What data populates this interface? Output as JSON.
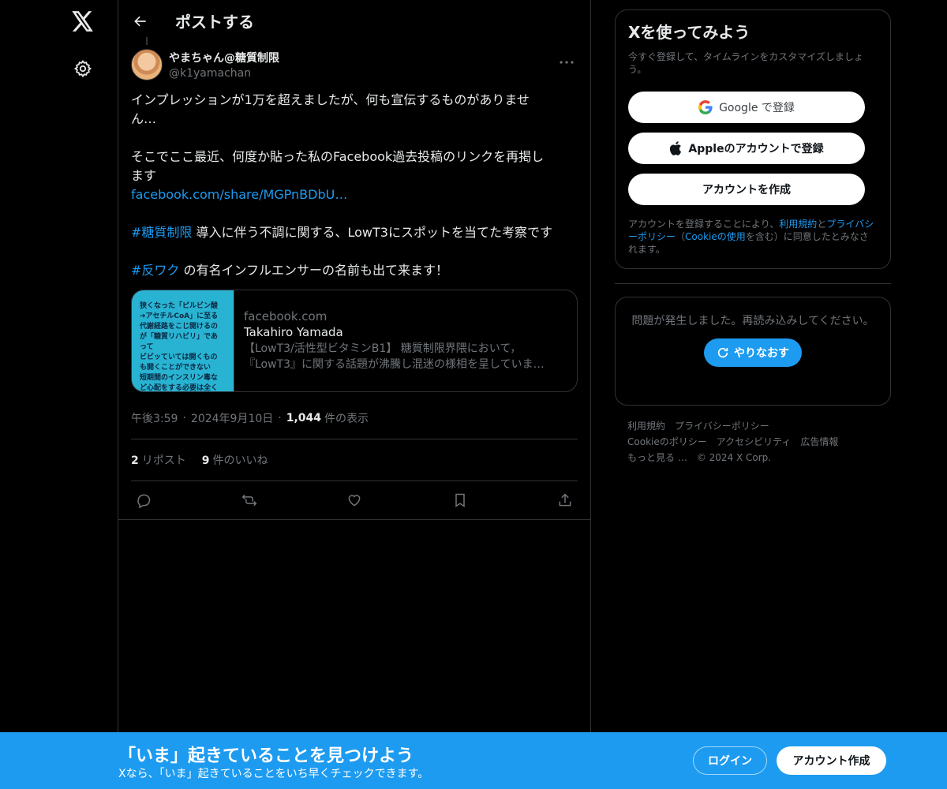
{
  "header": {
    "title": "ポストする"
  },
  "tweet": {
    "display_name": "やまちゃん@糖質制限",
    "handle": "@k1yamachan",
    "line1": "インプレッションが1万を超えましたが、何も宣伝するものがありませ",
    "line2": "ん…",
    "line3": "そこでここ最近、何度か貼った私のFacebook過去投稿のリンクを再掲し",
    "line4": "ます",
    "link": "facebook.com/share/MGPnBDbU…",
    "hashtag1": "#糖質制限",
    "line5": " 導入に伴う不調に関する、LowT3にスポットを当てた考察です",
    "hashtag2": "#反ワク",
    "line6": " の有名インフルエンサーの名前も出て来ます！",
    "card": {
      "thumb_text": "狭くなった「ピルビン酸\n➔アセチルCoA」に至る\n代謝経路をこじ開けるの\nが「糖質リハビリ」であ\nって\nビビッていては開くもの\nも開くことができない\n短期間のインスリン毒な\nど心配をする必要は全く",
      "domain": "facebook.com",
      "title": "Takahiro Yamada",
      "desc1": "【LowT3/活性型ビタミンB1】 糖質制限界隈において，",
      "desc2": "『LowT3』に関する話題が沸騰し混迷の様相を呈していま…"
    },
    "time": "午後3:59",
    "dot": "·",
    "date": "2024年9月10日",
    "views_count": "1,044",
    "views_label": "件の表示",
    "reposts_count": "2",
    "reposts_label": "リポスト",
    "likes_count": "9",
    "likes_label": "件のいいね"
  },
  "signup_panel": {
    "title": "Xを使ってみよう",
    "subtitle": "今すぐ登録して、タイムラインをカスタマイズしましょう。",
    "google_label": "Google で登録",
    "apple_label": "Appleのアカウントで登録",
    "create_label": "アカウントを作成",
    "legal_pre": "アカウントを登録することにより、",
    "legal_terms": "利用規約",
    "legal_and": "と",
    "legal_privacy": "プライバシーポリシー",
    "legal_mid": "（",
    "legal_cookie": "Cookieの使用",
    "legal_post": "を含む）に同意したとみなされます。"
  },
  "error_panel": {
    "message": "問題が発生しました。再読み込みしてください。",
    "retry_label": "やりなおす"
  },
  "footer": {
    "terms": "利用規約",
    "privacy": "プライバシーポリシー",
    "cookie": "Cookieのポリシー",
    "accessibility": "アクセシビリティ",
    "ads": "広告情報",
    "more": "もっと見る …",
    "copyright": "© 2024 X Corp."
  },
  "banner": {
    "title": "「いま」起きていることを見つけよう",
    "subtitle": "Xなら、「いま」起きていることをいち早くチェックできます。",
    "login_label": "ログイン",
    "signup_label": "アカウント作成"
  },
  "colors": {
    "accent": "#1d9bf0",
    "border": "#2f3336",
    "muted": "#71767b"
  }
}
